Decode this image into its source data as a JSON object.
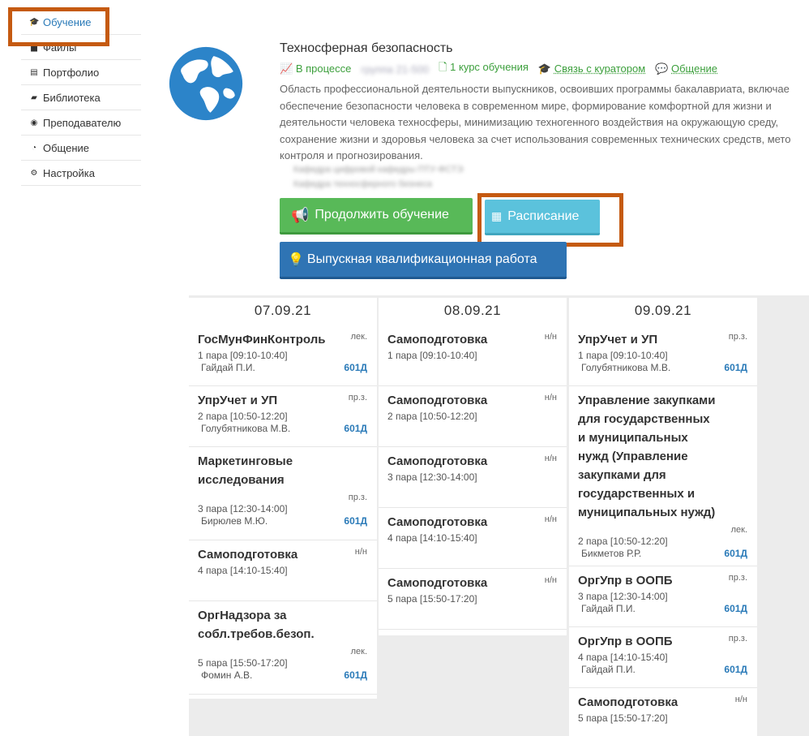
{
  "sidebar": {
    "items": [
      {
        "label": "Обучение",
        "icon": "graduation-cap-icon",
        "glyph": "🎓"
      },
      {
        "label": "Файлы",
        "icon": "file-icon",
        "glyph": "▆"
      },
      {
        "label": "Портфолио",
        "icon": "portfolio-icon",
        "glyph": "▤"
      },
      {
        "label": "Библиотека",
        "icon": "book-icon",
        "glyph": "▰"
      },
      {
        "label": "Преподавателю",
        "icon": "user-circle-icon",
        "glyph": "◉"
      },
      {
        "label": "Общение",
        "icon": "chat-icon",
        "glyph": "◔"
      },
      {
        "label": "Настройка",
        "icon": "gear-icon",
        "glyph": "⚙"
      }
    ]
  },
  "course": {
    "title": "Техносферная безопасность",
    "status": "В процессе",
    "status_blurred": "группа 21-500",
    "year": "1 курс обучения",
    "curator_link": "Связь с куратором",
    "chat_link": "Общение",
    "description": [
      "Область профессиональной деятельности выпускников, освоивших программы бакалавриата, включае",
      "обеспечение безопасности человека в современном мире, формирование комфортной для жизни и",
      "деятельности человека техносферы, минимизацию техногенного воздействия на окружающую среду,",
      "сохранение жизни и здоровья человека за счет использования современных технических средств, мето",
      "контроля и прогнозирования."
    ],
    "blurred_links": [
      "Кафедра цифровой кафедры ПТУ-ФСТЭ",
      "Кафедра техносферного бизнеса"
    ]
  },
  "buttons": {
    "continue": "Продолжить обучение",
    "schedule": "Расписание",
    "thesis": "Выпускная квалификационная работа"
  },
  "schedule": [
    {
      "date": "07.09.21",
      "lessons": [
        {
          "subject": "ГосМунФинКонтроль",
          "type": "лек.",
          "time": "1 пара [09:10-10:40]",
          "teacher": "Гайдай П.И.",
          "room": "601Д"
        },
        {
          "subject": "УпрУчет и УП",
          "type": "пр.з.",
          "time": "2 пара [10:50-12:20]",
          "teacher": "Голубятникова М.В.",
          "room": "601Д"
        },
        {
          "subject": "Маркетинговые исследования",
          "type": "пр.з.",
          "time": "3 пара [12:30-14:00]",
          "teacher": "Бирюлев М.Ю.",
          "room": "601Д"
        },
        {
          "subject": "Самоподготовка",
          "type": "н/н",
          "time": "4 пара [14:10-15:40]",
          "teacher": "",
          "room": ""
        },
        {
          "subject": "ОргНадзора за собл.требов.безоп.",
          "type": "лек.",
          "time": "5 пара [15:50-17:20]",
          "teacher": "Фомин А.В.",
          "room": "601Д"
        }
      ]
    },
    {
      "date": "08.09.21",
      "lessons": [
        {
          "subject": "Самоподготовка",
          "type": "н/н",
          "time": "1 пара [09:10-10:40]",
          "teacher": "",
          "room": ""
        },
        {
          "subject": "Самоподготовка",
          "type": "н/н",
          "time": "2 пара [10:50-12:20]",
          "teacher": "",
          "room": ""
        },
        {
          "subject": "Самоподготовка",
          "type": "н/н",
          "time": "3 пара [12:30-14:00]",
          "teacher": "",
          "room": ""
        },
        {
          "subject": "Самоподготовка",
          "type": "н/н",
          "time": "4 пара [14:10-15:40]",
          "teacher": "",
          "room": ""
        },
        {
          "subject": "Самоподготовка",
          "type": "н/н",
          "time": "5 пара [15:50-17:20]",
          "teacher": "",
          "room": ""
        }
      ]
    },
    {
      "date": "09.09.21",
      "lessons": [
        {
          "subject": "УпрУчет и УП",
          "type": "пр.з.",
          "time": "1 пара [09:10-10:40]",
          "teacher": "Голубятникова М.В.",
          "room": "601Д"
        },
        {
          "subject": "Управление закупками для государственных и муниципальных нужд (Управление закупками для государственных и муниципальных нужд)",
          "type": "лек.",
          "time": "2 пара [10:50-12:20]",
          "teacher": "Бикметов Р.Р.",
          "room": "601Д"
        },
        {
          "subject": "ОргУпр в ООПБ",
          "type": "пр.з.",
          "time": "3 пара [12:30-14:00]",
          "teacher": "Гайдай П.И.",
          "room": "601Д"
        },
        {
          "subject": "ОргУпр в ООПБ",
          "type": "пр.з.",
          "time": "4 пара [14:10-15:40]",
          "teacher": "Гайдай П.И.",
          "room": "601Д"
        },
        {
          "subject": "Самоподготовка",
          "type": "н/н",
          "time": "5 пара [15:50-17:20]",
          "teacher": "",
          "room": ""
        }
      ]
    }
  ],
  "colors": {
    "accent": "#2a7ab8",
    "green": "#58b958",
    "teal": "#5bc2dc",
    "blue": "#2f74b4",
    "highlight": "#c55a11"
  }
}
